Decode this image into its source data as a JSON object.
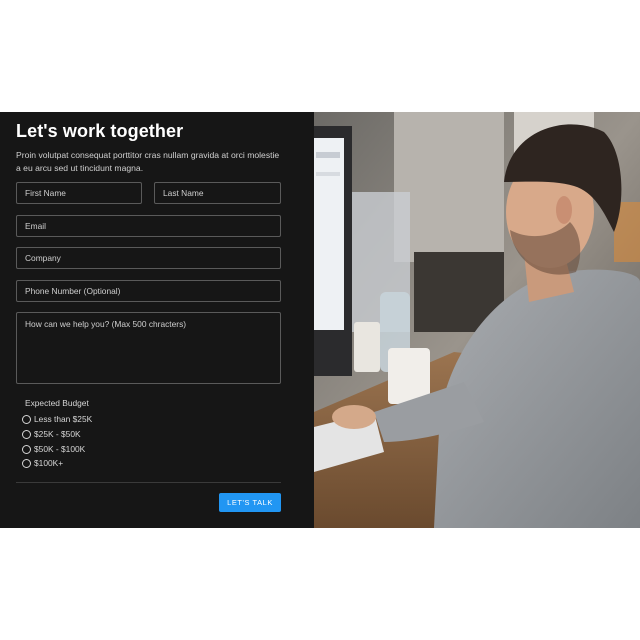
{
  "form": {
    "title": "Let's work together",
    "subtitle": "Proin volutpat consequat porttitor cras nullam gravida at orci molestie a eu arcu sed ut tincidunt magna.",
    "first_name_placeholder": "First Name",
    "last_name_placeholder": "Last Name",
    "email_placeholder": "Email",
    "company_placeholder": "Company",
    "phone_placeholder": "Phone Number (Optional)",
    "message_placeholder": "How can we help you? (Max 500 chracters)",
    "budget_label": "Expected Budget",
    "budget_options": [
      "Less than $25K",
      "$25K - $50K",
      "$50K - $100K",
      "$100K+"
    ],
    "submit_label": "LET'S TALK"
  },
  "colors": {
    "panel_bg": "#161616",
    "accent": "#2196f3"
  }
}
